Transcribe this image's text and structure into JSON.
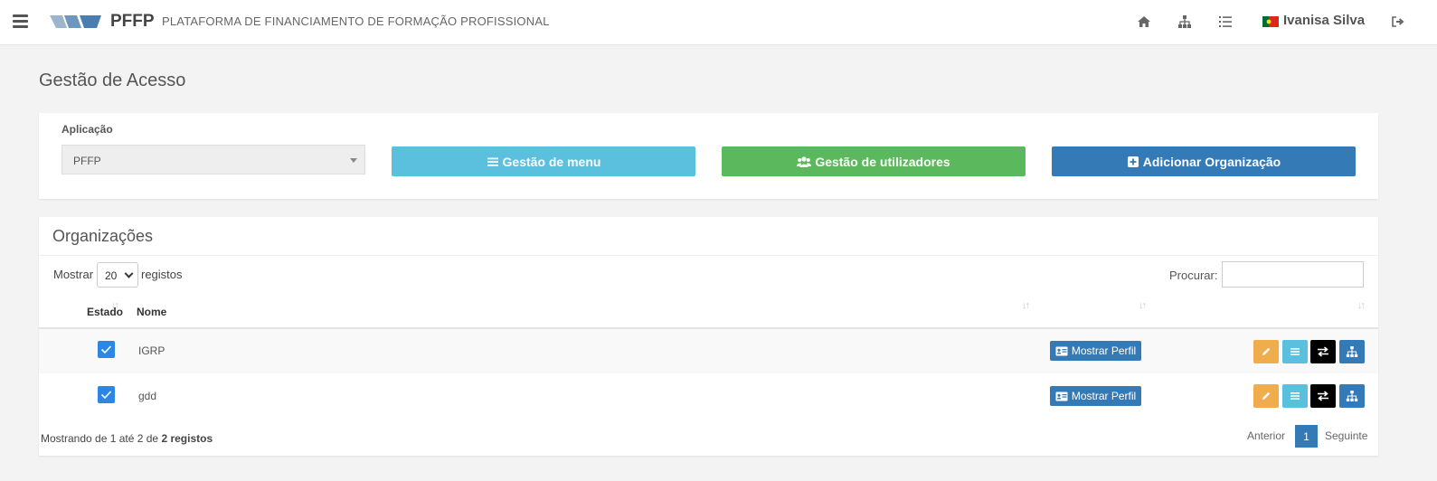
{
  "header": {
    "brand": "PFFP",
    "subtitle": "PLATAFORMA DE FINANCIAMENTO DE FORMAÇÃO PROFISSIONAL",
    "user_name": "Ivanisa Silva",
    "icons": [
      "menu-icon",
      "home-icon",
      "sitemap-icon",
      "list-ol-icon",
      "flag-portugal-icon",
      "sign-out-icon"
    ]
  },
  "page": {
    "title": "Gestão de Acesso"
  },
  "filters": {
    "app_label": "Aplicação",
    "app_value": "PFFP",
    "menu_button": "Gestão de menu",
    "users_button": "Gestão de utilizadores",
    "add_org_button": "Adicionar Organização"
  },
  "orgs": {
    "title": "Organizações",
    "show_label": "Mostrar",
    "page_length": "20",
    "records_label": "registos",
    "search_label": "Procurar:",
    "search_value": "",
    "columns": {
      "estado": "Estado",
      "nome": "Nome"
    },
    "rows": [
      {
        "checked": true,
        "name": "IGRP",
        "profile_button": "Mostrar Perfil"
      },
      {
        "checked": true,
        "name": "gdd",
        "profile_button": "Mostrar Perfil"
      }
    ],
    "info_prefix": "Mostrando de 1 até 2 de ",
    "info_total": "2 registos",
    "pagination": {
      "prev": "Anterior",
      "current": "1",
      "next": "Seguinte"
    }
  },
  "colors": {
    "info": "#5bc0de",
    "success": "#5cb85c",
    "primary": "#337ab7",
    "warning": "#f0ad4e",
    "checkbox": "#2b87e3"
  }
}
